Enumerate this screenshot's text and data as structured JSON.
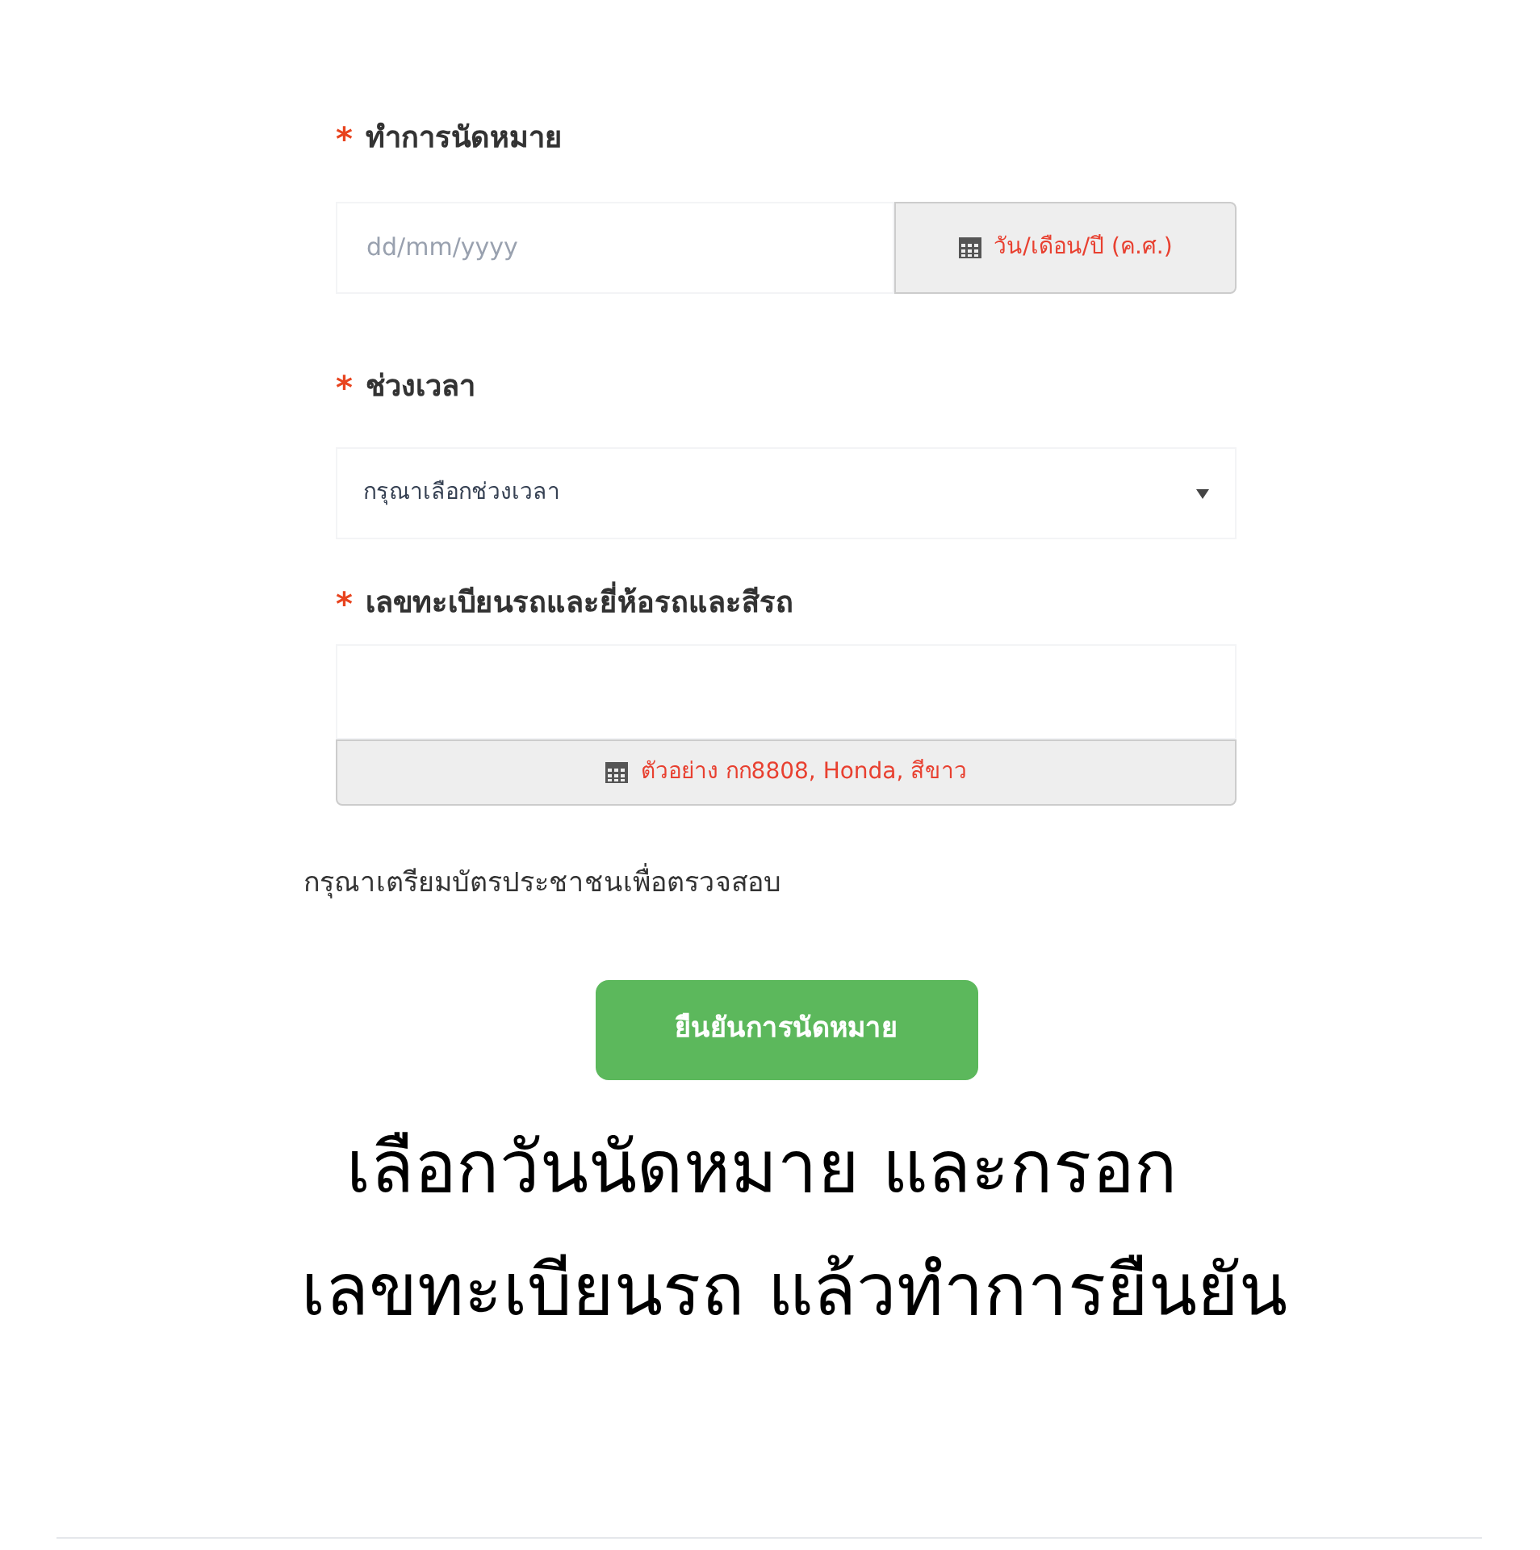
{
  "fields": [
    {
      "kind": "date",
      "label": "ทำการนัดหมาย",
      "required_mark": "*",
      "placeholder": "dd/mm/yyyy",
      "addon": "วัน/เดือน/ปี (ค.ศ.)"
    },
    {
      "kind": "select",
      "label": "ช่วงเวลา",
      "required_mark": "*",
      "value": "กรุณาเลือกช่วงเวลา"
    },
    {
      "kind": "text",
      "label": "เลขทะเบียนรถและยี่ห้อรถและสีรถ",
      "required_mark": "*",
      "addon": "ตัวอย่าง กก8808, Honda, สีขาว"
    }
  ],
  "note": "กรุณาเตรียมบัตรประชาชนเพื่อตรวจสอบ",
  "submit": "ยืนยันการนัดหมาย",
  "caption": [
    "เลือกวันนัดหมาย และกรอก",
    "เลขทะเบียนรถ แล้วทำการยืนยัน"
  ]
}
